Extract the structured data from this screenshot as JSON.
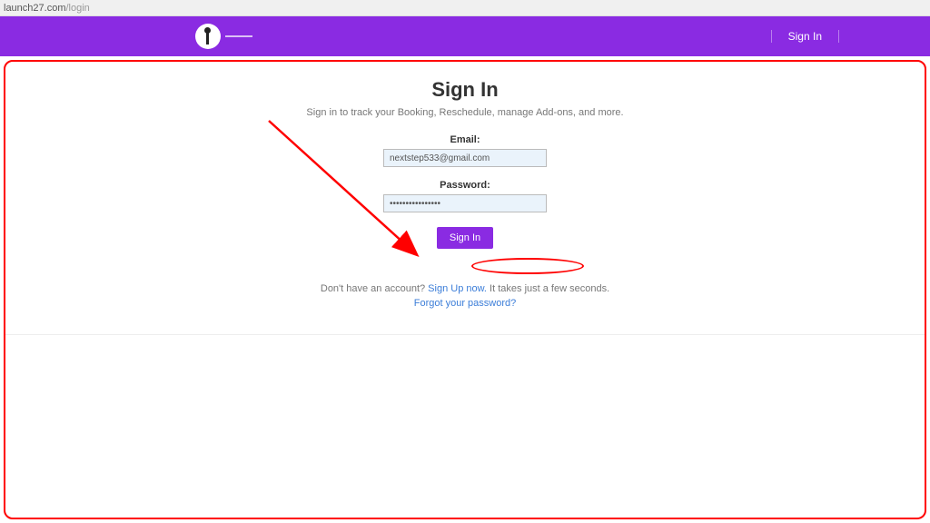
{
  "browser": {
    "domain": "launch27.com",
    "path": "/login"
  },
  "nav": {
    "signInLabel": "Sign In"
  },
  "page": {
    "title": "Sign In",
    "subtitle": "Sign in to track your Booking, Reschedule, manage Add-ons, and more.",
    "emailLabel": "Email:",
    "emailValue": "nextstep533@gmail.com",
    "passwordLabel": "Password:",
    "passwordValue": "••••••••••••••••",
    "submitLabel": "Sign In",
    "noAccountPrefix": "Don't have an account? ",
    "signUpLinkText": "Sign Up now.",
    "noAccountSuffix": " It takes just a few seconds.",
    "forgotText": "Forgot your password?"
  },
  "colors": {
    "accent": "#8a2be2",
    "annotation": "#ff0000",
    "link": "#3b7dd8"
  }
}
